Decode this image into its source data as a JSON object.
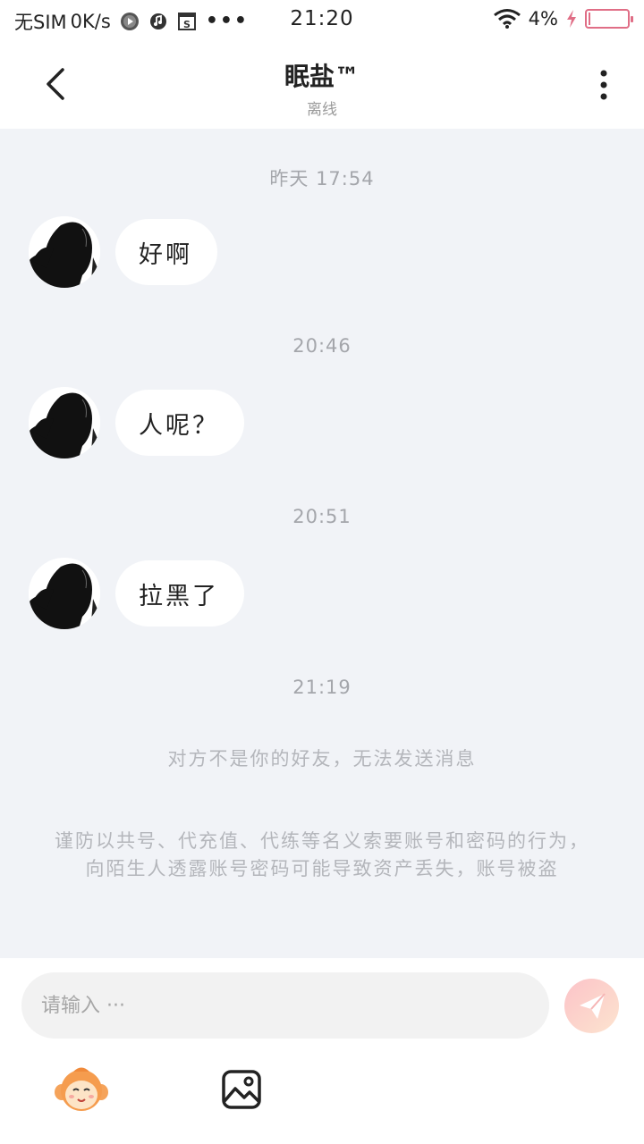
{
  "status_bar": {
    "sim": "无SIM",
    "net_speed": "0K/s",
    "time": "21:20",
    "battery_percent": "4%",
    "battery_level": 0.04,
    "icons": [
      "play-icon",
      "music-icon",
      "s-icon",
      "more-dots",
      "wifi-icon",
      "charging-icon",
      "battery-icon"
    ]
  },
  "header": {
    "title": "眠盐™",
    "status": "离线"
  },
  "messages": [
    {
      "time": "昨天 17:54",
      "text": "好啊"
    },
    {
      "time": "20:46",
      "text": "人呢？"
    },
    {
      "time": "20:51",
      "text": "拉黑了"
    }
  ],
  "system": {
    "time": "21:19",
    "not_friend": "对方不是你的好友，无法发送消息",
    "warning": "谨防以共号、代充值、代练等名义索要账号和密码的行为，向陌生人透露账号密码可能导致资产丢失，账号被盗"
  },
  "input": {
    "placeholder": "请输入 ···",
    "value": ""
  },
  "colors": {
    "chat_bg": "#f1f3f7",
    "bubble_bg": "#ffffff",
    "send_gradient_start": "#fbc3c8",
    "send_gradient_end": "#fde4cf",
    "battery_low": "#e06e86"
  }
}
